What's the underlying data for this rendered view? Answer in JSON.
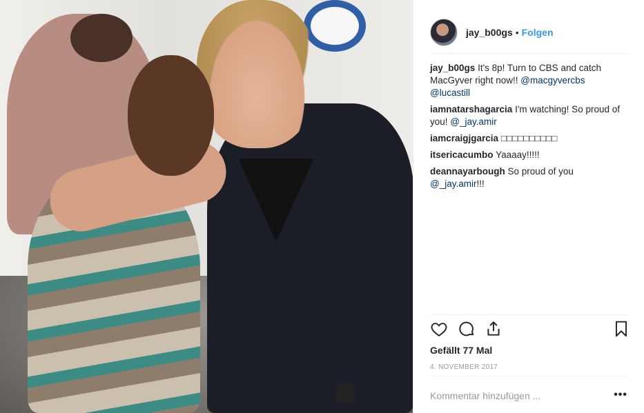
{
  "post": {
    "author": {
      "username": "jay_b00gs",
      "follow_label": "Folgen",
      "separator": "•"
    },
    "photo": {
      "description_icon": "post-photo"
    },
    "comments": [
      {
        "username": "jay_b00gs",
        "parts": [
          {
            "text": "It's 8p! Turn to CBS and catch MacGyver right now!! ",
            "mention": false
          },
          {
            "text": "@macgyvercbs",
            "mention": true
          },
          {
            "text": " ",
            "mention": false
          },
          {
            "text": "@lucastill",
            "mention": true
          }
        ]
      },
      {
        "username": "iamnatarshagarcia",
        "parts": [
          {
            "text": "I'm watching! So proud of you! ",
            "mention": false
          },
          {
            "text": "@_jay.amir",
            "mention": true
          }
        ]
      },
      {
        "username": "iamcraigjgarcia",
        "parts": [
          {
            "text": "□□□□□□□□□□",
            "mention": false
          }
        ]
      },
      {
        "username": "itsericacumbo",
        "parts": [
          {
            "text": "Yaaaay!!!!!",
            "mention": false
          }
        ]
      },
      {
        "username": "deannayarbough",
        "parts": [
          {
            "text": "So proud of you ",
            "mention": false
          },
          {
            "text": "@_jay.amir",
            "mention": true
          },
          {
            "text": "!!!",
            "mention": false
          }
        ]
      }
    ],
    "actions": {
      "like_icon": "heart-icon",
      "comment_icon": "comment-icon",
      "share_icon": "share-icon",
      "save_icon": "bookmark-icon"
    },
    "likes_label": "Gefällt 77 Mal",
    "date_label": "4. NOVEMBER 2017",
    "add_comment_placeholder": "Kommentar hinzufügen ...",
    "more_label": "•••"
  },
  "colors": {
    "link": "#3897f0",
    "mention": "#003569",
    "text": "#262626",
    "muted": "#999999"
  }
}
